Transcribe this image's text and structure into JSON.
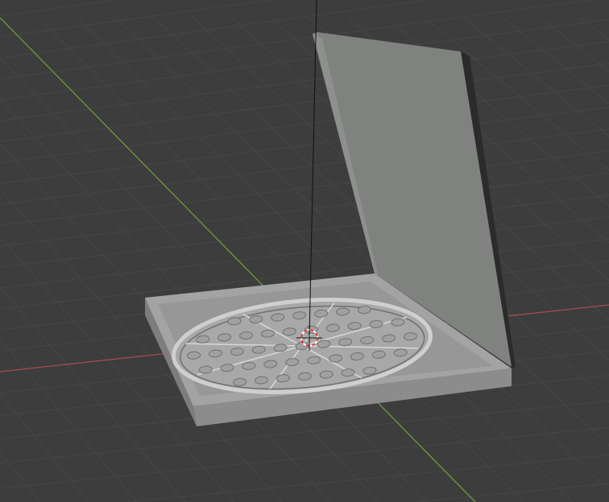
{
  "viewport": {
    "colors": {
      "background": "#3d3d3d",
      "grid": "#474747",
      "x_axis": "#a34b4b",
      "y_axis": "#6d9a3a",
      "box_top": "#9c9c9c",
      "box_side": "#8a8a8a",
      "lid": "#7f827f",
      "lid_edge": "#2a2a2a",
      "pizza": "#a4a4a4"
    },
    "objects": [
      "3d-cursor",
      "pizza-box",
      "pizza-box-lid",
      "pizza"
    ]
  }
}
